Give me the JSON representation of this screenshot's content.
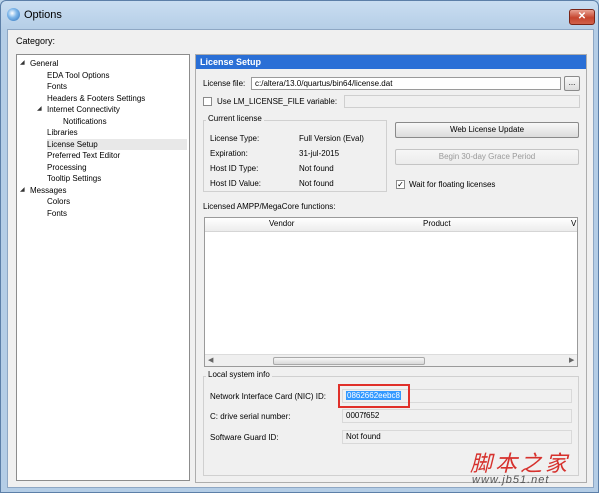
{
  "window": {
    "title": "Options",
    "close_glyph": "✕"
  },
  "category_label": "Category:",
  "tree": {
    "items": [
      {
        "label": "General",
        "twisty": "◢"
      },
      {
        "label": "EDA Tool Options"
      },
      {
        "label": "Fonts"
      },
      {
        "label": "Headers & Footers Settings"
      },
      {
        "label": "Internet Connectivity",
        "twisty": "◢"
      },
      {
        "label": "Notifications"
      },
      {
        "label": "Libraries"
      },
      {
        "label": "License Setup",
        "selected": true
      },
      {
        "label": "Preferred Text Editor"
      },
      {
        "label": "Processing"
      },
      {
        "label": "Tooltip Settings"
      },
      {
        "label": "Messages",
        "twisty": "◢"
      },
      {
        "label": "Colors"
      },
      {
        "label": "Fonts"
      }
    ]
  },
  "panel": {
    "header": "License Setup",
    "license_file_label": "License file:",
    "license_file_value": "c:/altera/13.0/quartus/bin64/license.dat",
    "browse_label": "...",
    "use_lm_label": "Use LM_LICENSE_FILE variable:",
    "current_license": {
      "title": "Current license",
      "rows": [
        {
          "label": "License Type:",
          "value": "Full Version (Eval)"
        },
        {
          "label": "Expiration:",
          "value": "31-jul-2015"
        },
        {
          "label": "Host ID Type:",
          "value": "Not found"
        },
        {
          "label": "Host ID Value:",
          "value": "Not found"
        }
      ]
    },
    "web_update_label": "Web License Update",
    "grace_label": "Begin 30-day Grace Period",
    "wait_label": "Wait for floating licenses",
    "wait_checked": "✓",
    "ampp_label": "Licensed AMPP/MegaCore functions:",
    "columns": [
      "Vendor",
      "Product",
      "V"
    ],
    "scroll_left": "◀",
    "scroll_right": "▶",
    "local": {
      "title": "Local system info",
      "nic_label": "Network Interface Card (NIC) ID:",
      "nic_value": "0862662eebc8",
      "drive_label": "C: drive serial number:",
      "drive_value": "0007f652",
      "guard_label": "Software Guard ID:",
      "guard_value": "Not found"
    }
  },
  "watermark": {
    "cn": "脚本之家",
    "url": "www.jb51.net"
  },
  "colors": {
    "header_blue": "#2a6fd6",
    "highlight_red": "#e0302a",
    "selection": "#3399ff"
  }
}
